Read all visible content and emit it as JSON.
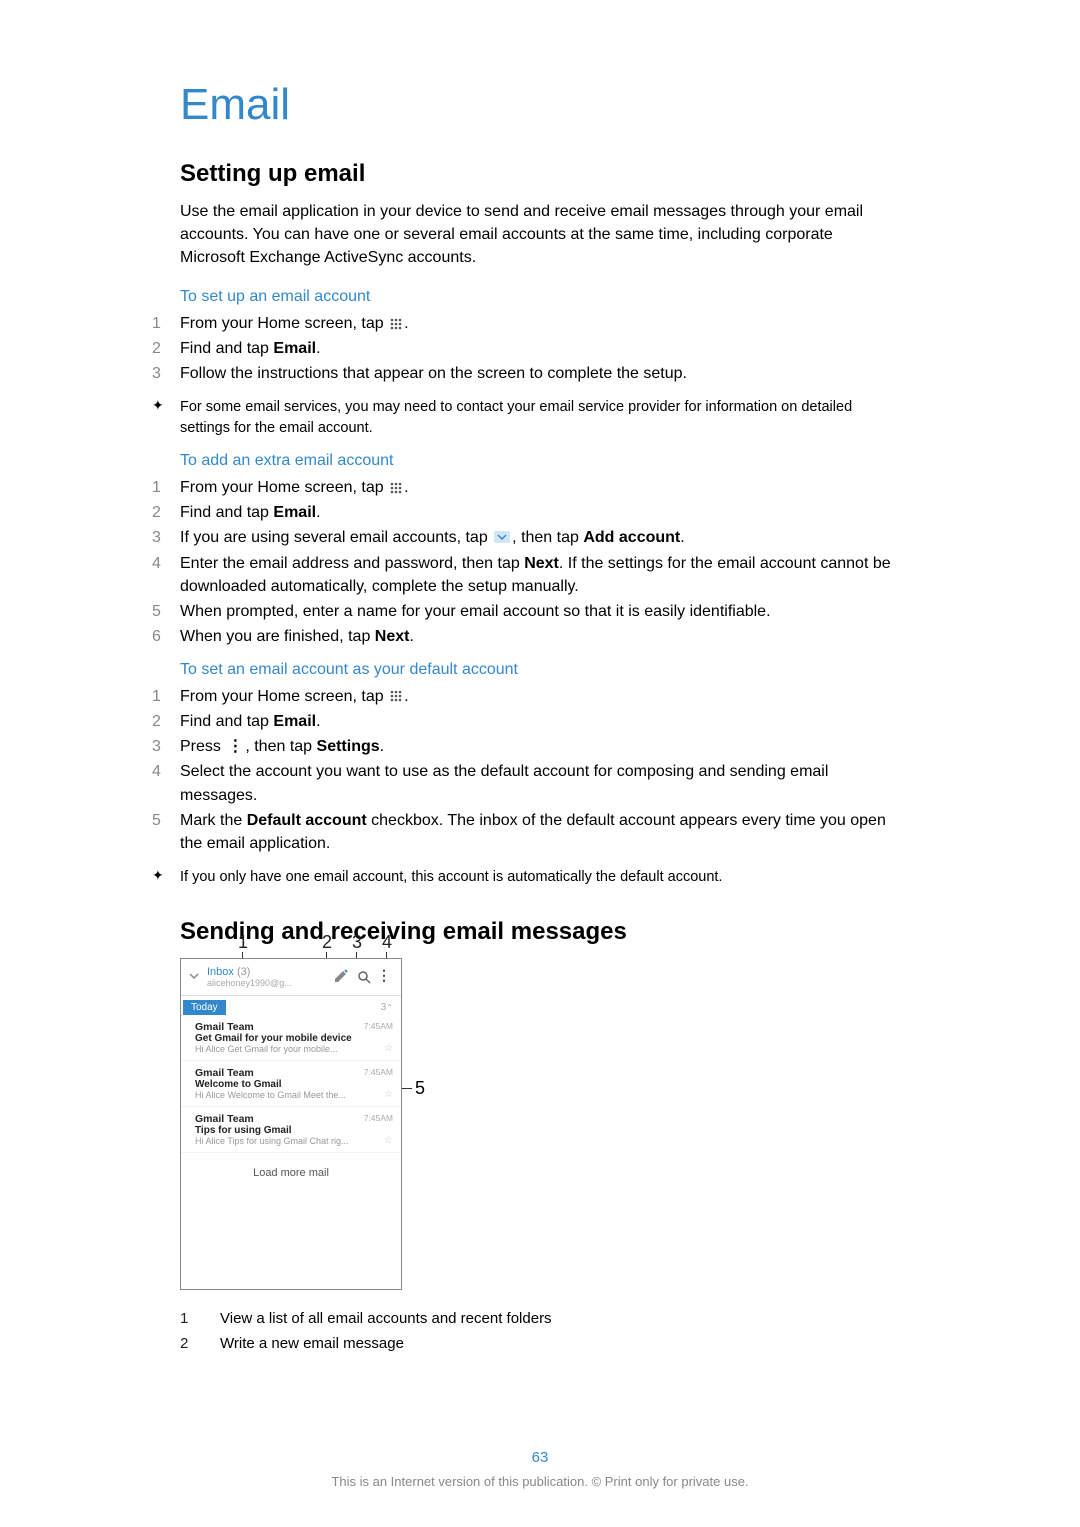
{
  "title": "Email",
  "section1": {
    "heading": "Setting up email",
    "intro": "Use the email application in your device to send and receive email messages through your email accounts. You can have one or several email accounts at the same time, including corporate Microsoft Exchange ActiveSync accounts.",
    "sub1": "To set up an email account",
    "steps1": {
      "n1": "1",
      "t1a": "From your Home screen, tap ",
      "t1b": ".",
      "n2": "2",
      "t2a": "Find and tap ",
      "t2b": "Email",
      "t2c": ".",
      "n3": "3",
      "t3": "Follow the instructions that appear on the screen to complete the setup."
    },
    "tip1": "For some email services, you may need to contact your email service provider for information on detailed settings for the email account.",
    "sub2": "To add an extra email account",
    "steps2": {
      "n1": "1",
      "t1a": "From your Home screen, tap ",
      "t1b": ".",
      "n2": "2",
      "t2a": "Find and tap ",
      "t2b": "Email",
      "t2c": ".",
      "n3": "3",
      "t3a": "If you are using several email accounts, tap ",
      "t3b": ", then tap ",
      "t3c": "Add account",
      "t3d": ".",
      "n4": "4",
      "t4a": "Enter the email address and password, then tap ",
      "t4b": "Next",
      "t4c": ". If the settings for the email account cannot be downloaded automatically, complete the setup manually.",
      "n5": "5",
      "t5": "When prompted, enter a name for your email account so that it is easily identifiable.",
      "n6": "6",
      "t6a": "When you are finished, tap ",
      "t6b": "Next",
      "t6c": "."
    },
    "sub3": "To set an email account as your default account",
    "steps3": {
      "n1": "1",
      "t1a": "From your Home screen, tap ",
      "t1b": ".",
      "n2": "2",
      "t2a": "Find and tap ",
      "t2b": "Email",
      "t2c": ".",
      "n3": "3",
      "t3a": "Press ",
      "t3b": ", then tap ",
      "t3c": "Settings",
      "t3d": ".",
      "n4": "4",
      "t4": "Select the account you want to use as the default account for composing and sending email messages.",
      "n5": "5",
      "t5a": "Mark the ",
      "t5b": "Default account",
      "t5c": " checkbox. The inbox of the default account appears every time you open the email application."
    },
    "tip2": "If you only have one email account, this account is automatically the default account."
  },
  "section2": {
    "heading": "Sending and receiving email messages",
    "callouts": {
      "c1": "1",
      "c2": "2",
      "c3": "3",
      "c4": "4",
      "c5": "5"
    },
    "phone": {
      "inbox_label": "Inbox",
      "inbox_count": "(3)",
      "inbox_sub": "alicehoney1990@g...",
      "today": "Today",
      "count": "3",
      "loadmore": "Load more mail",
      "msgs": [
        {
          "from": "Gmail Team",
          "subj": "Get Gmail for your mobile device",
          "prev": "Hi Alice Get Gmail for your mobile...",
          "time": "7:45AM"
        },
        {
          "from": "Gmail Team",
          "subj": "Welcome to Gmail",
          "prev": "Hi Alice Welcome to Gmail Meet the...",
          "time": "7:45AM"
        },
        {
          "from": "Gmail Team",
          "subj": "Tips for using Gmail",
          "prev": "Hi Alice Tips for using Gmail Chat rig...",
          "time": "7:45AM"
        }
      ]
    },
    "legend": {
      "r1n": "1",
      "r1t": "View a list of all email accounts and recent folders",
      "r2n": "2",
      "r2t": "Write a new email message"
    }
  },
  "footer": {
    "page": "63",
    "text": "This is an Internet version of this publication. © Print only for private use."
  }
}
